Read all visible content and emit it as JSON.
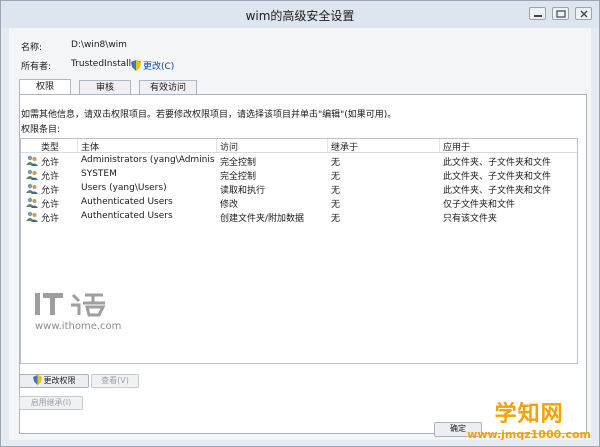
{
  "window": {
    "title": "wim的高级安全设置",
    "controls": [
      "minimize-icon",
      "restore-icon",
      "close-icon"
    ]
  },
  "fields": {
    "name_label": "名称:",
    "name_value": "D:\\win8\\wim",
    "owner_label": "所有者:",
    "owner_value": "TrustedInstaller",
    "change_link": "更改(C)"
  },
  "tabs": [
    {
      "label": "权限",
      "active": true
    },
    {
      "label": "审核",
      "active": false
    },
    {
      "label": "有效访问",
      "active": false
    }
  ],
  "panel": {
    "info_text": "如需其他信息，请双击权限项目。若要修改权限项目，请选择该项目并单击\"编辑\"(如果可用)。",
    "entries_label": "权限条目:"
  },
  "table": {
    "columns": [
      "类型",
      "主体",
      "访问",
      "继承于",
      "应用于"
    ],
    "rows": [
      {
        "type": "允许",
        "principal": "Administrators (yang\\Administra...",
        "access": "完全控制",
        "inherited": "无",
        "applies": "此文件夹、子文件夹和文件"
      },
      {
        "type": "允许",
        "principal": "SYSTEM",
        "access": "完全控制",
        "inherited": "无",
        "applies": "此文件夹、子文件夹和文件"
      },
      {
        "type": "允许",
        "principal": "Users (yang\\Users)",
        "access": "读取和执行",
        "inherited": "无",
        "applies": "此文件夹、子文件夹和文件"
      },
      {
        "type": "允许",
        "principal": "Authenticated Users",
        "access": "修改",
        "inherited": "无",
        "applies": "仅子文件夹和文件"
      },
      {
        "type": "允许",
        "principal": "Authenticated Users",
        "access": "创建文件夹/附加数据",
        "inherited": "无",
        "applies": "只有该文件夹"
      }
    ]
  },
  "buttons": {
    "change_permissions": "更改权限",
    "view": "查看(V)",
    "enable_inheritance": "启用继承(I)",
    "ok": "确定"
  },
  "watermarks": {
    "ithome_logo": "IT之家",
    "ithome_url": "www.ithome.com",
    "site_name": "学知网",
    "site_url": "www.jmqz1000.com"
  },
  "colors": {
    "accent_link": "#0d47a1",
    "watermark_orange": "#f8a000"
  }
}
